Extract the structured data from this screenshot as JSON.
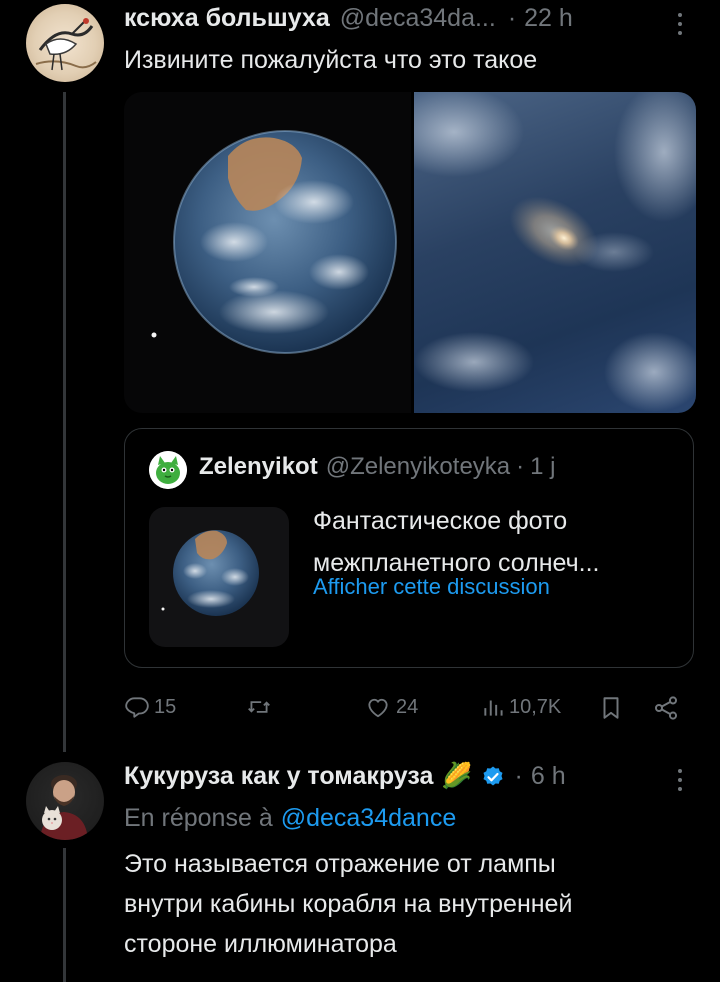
{
  "tweet1": {
    "author_name": "ксюха большуха",
    "author_handle": "@deca34da...",
    "separator": "·",
    "time": "22 h",
    "text": "Извините пожалуйста что это такое",
    "stats": {
      "replies": "15",
      "retweets": "",
      "likes": "24",
      "views": "10,7K"
    }
  },
  "quote": {
    "author_name": "Zelenyikot",
    "author_handle": "@Zelenyikoteyka",
    "separator": "·",
    "time": "1 j",
    "text_line1": "Фантастическое фото",
    "text_line2": "межпланетного солнеч...",
    "show_thread": "Afficher cette discussion"
  },
  "tweet2": {
    "author_name": "Кукуруза как у томакруза",
    "emoji": "🌽",
    "separator": "·",
    "time": "6 h",
    "reply_prefix": "En réponse à",
    "reply_handle": "@deca34dance",
    "text_line1": "Это называется отражение от лампы",
    "text_line2": "внутри кабины корабля на внутренней",
    "text_line3": "стороне иллюминатора"
  },
  "colors": {
    "background": "#000000",
    "text": "#e7e9ea",
    "muted": "#71767b",
    "link": "#1d9bf0",
    "verified": "#1d9bf0",
    "border": "#2f3336"
  },
  "icons": {
    "reply": "reply-icon",
    "retweet": "retweet-icon",
    "like": "heart-icon",
    "views": "views-icon",
    "bookmark": "bookmark-icon",
    "share": "share-icon",
    "more": "more-icon",
    "verified": "verified-badge-icon"
  }
}
